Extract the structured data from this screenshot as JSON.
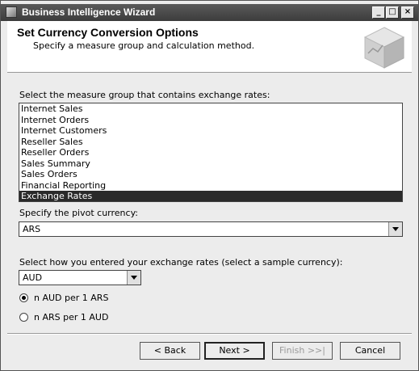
{
  "window": {
    "title": "Business Intelligence Wizard"
  },
  "header": {
    "title": "Set Currency Conversion Options",
    "subtitle": "Specify a measure group and calculation method."
  },
  "measure_group": {
    "label": "Select the measure group that contains exchange rates:",
    "items": [
      "Internet Sales",
      "Internet Orders",
      "Internet Customers",
      "Reseller Sales",
      "Reseller Orders",
      "Sales Summary",
      "Sales Orders",
      "Financial Reporting",
      "Exchange Rates"
    ],
    "selected": "Exchange Rates"
  },
  "pivot_currency": {
    "label": "Specify the pivot currency:",
    "value": "ARS"
  },
  "sample_currency": {
    "label": "Select how you entered your exchange rates (select a sample currency):",
    "value": "AUD"
  },
  "options": [
    {
      "label": "n AUD per 1 ARS",
      "checked": true
    },
    {
      "label": "n ARS per 1 AUD",
      "checked": false
    }
  ],
  "buttons": {
    "back": "< Back",
    "next": "Next >",
    "finish": "Finish >>|",
    "cancel": "Cancel"
  },
  "icons": {
    "app": "wizard-app-icon",
    "header": "cube-icon"
  }
}
